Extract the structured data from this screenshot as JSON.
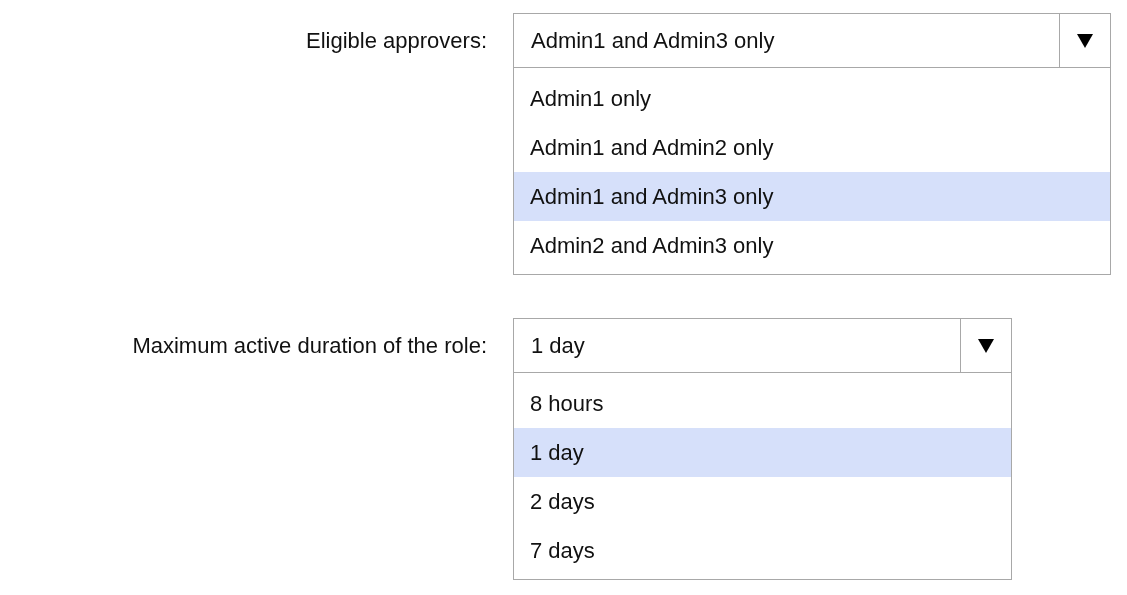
{
  "dropdowns": [
    {
      "label": "Eligible approvers:",
      "value": "Admin1 and Admin3 only",
      "expanded": true,
      "options": [
        {
          "text": "Admin1 only",
          "selected": false
        },
        {
          "text": "Admin1 and Admin2 only",
          "selected": false
        },
        {
          "text": "Admin1 and Admin3 only",
          "selected": true
        },
        {
          "text": "Admin2 and Admin3 only",
          "selected": false
        }
      ]
    },
    {
      "label": "Maximum active duration of the role:",
      "value": "1 day",
      "expanded": true,
      "options": [
        {
          "text": "8 hours",
          "selected": false
        },
        {
          "text": "1 day",
          "selected": true
        },
        {
          "text": "2 days",
          "selected": false
        },
        {
          "text": "7 days",
          "selected": false
        }
      ]
    }
  ]
}
